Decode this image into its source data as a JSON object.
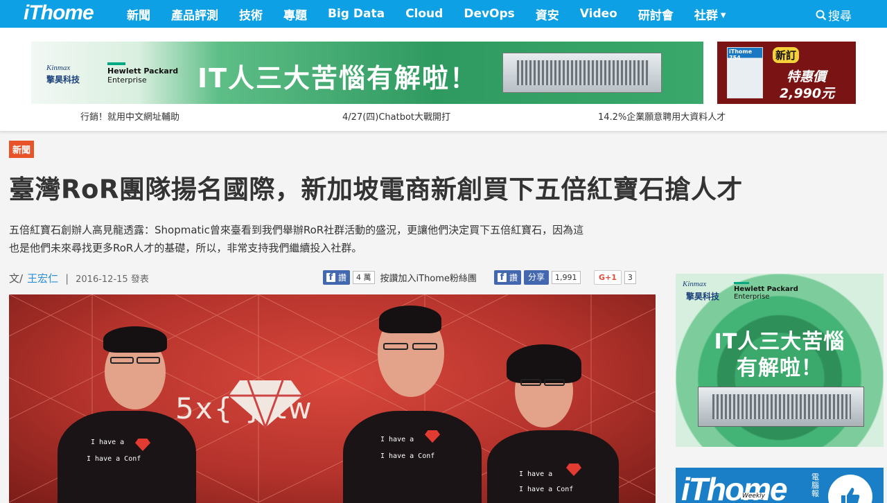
{
  "nav": {
    "logo": "iThome",
    "items": [
      "新聞",
      "產品評測",
      "技術",
      "專題",
      "Big Data",
      "Cloud",
      "DevOps",
      "資安",
      "Video",
      "研討會",
      "社群"
    ],
    "search_label": "搜尋"
  },
  "banner_main": {
    "brand_en": "Kinmax",
    "brand_cn": "擎昊科技",
    "partner_line1": "Hewlett Packard",
    "partner_line2": "Enterprise",
    "headline": "IT人三大苦惱有解啦！"
  },
  "banner_side": {
    "magazine": "iThome 754",
    "badge": "新訂",
    "label": "特惠價",
    "price": "2,990元"
  },
  "header_links": [
    "行銷！就用中文網址輔助",
    "4/27(四)Chatbot大戰開打",
    "14.2%企業願意聘用大資料人才"
  ],
  "article": {
    "category": "新聞",
    "title": "臺灣RoR團隊揚名國際，新加坡電商新創買下五倍紅寶石搶人才",
    "summary": "五倍紅寶石創辦人高見龍透露：Shopmatic曾來臺看到我們舉辦RoR社群活動的盛況，更讓他們決定買下五倍紅寶石，因為這也是他們未來尋找更多RoR人才的基礎，所以，非常支持我們繼續投入社群。",
    "byline_prefix": "文/",
    "author": "王宏仁",
    "date": "2016-12-15 發表"
  },
  "social": {
    "fb_like_label": "讚",
    "fb_like_count": "4 萬",
    "fan_text": "按讚加入iThome粉絲團",
    "fb_like2_label": "讚",
    "share_label": "分享",
    "share_count": "1,991",
    "gplus_label": "G+1",
    "gplus_count": "3"
  },
  "photo": {
    "wall_text": "5x{    }·tw",
    "shirt_line1": "I have a",
    "shirt_line2": "I have a Conf"
  },
  "side_ad": {
    "brand_en": "Kinmax",
    "brand_cn": "擎昊科技",
    "partner_line1": "Hewlett Packard",
    "partner_line2": "Enterprise",
    "headline_line1": "IT人三大苦惱",
    "headline_line2": "有解啦！"
  },
  "side_ad2": {
    "logo": "iThome",
    "weekly": "Weekly",
    "cn": "電腦報"
  },
  "colors": {
    "nav_bg": "#0ea0e4",
    "category_tag": "#e8532a",
    "author_link": "#2a8fd6",
    "facebook": "#4468b0"
  }
}
